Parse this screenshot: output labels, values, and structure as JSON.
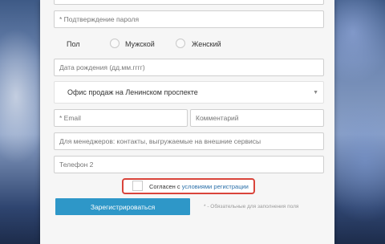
{
  "form": {
    "confirm_password_placeholder": "* Подтверждение пароля",
    "gender_label": "Пол",
    "gender_options": [
      "Мужской",
      "Женский"
    ],
    "birth_date_placeholder": "Дата рождения (дд.мм.гггг)",
    "office_select_value": "Офис продаж на Ленинском проспекте",
    "email_placeholder": "* Email",
    "comment_placeholder": "Комментарий",
    "managers_placeholder": "Для менеджеров: контакты, выгружаемые на внешние сервисы",
    "phone2_placeholder": "Телефон 2",
    "agree_text": "Согласен с ",
    "agree_link": "условиями регистрации",
    "submit_label": "Зарегистрироваться",
    "required_note": "* - Обязательные для заполнения поля"
  },
  "colors": {
    "button": "#2e97c8",
    "highlight": "#d9443b",
    "link": "#2a6fa8"
  }
}
